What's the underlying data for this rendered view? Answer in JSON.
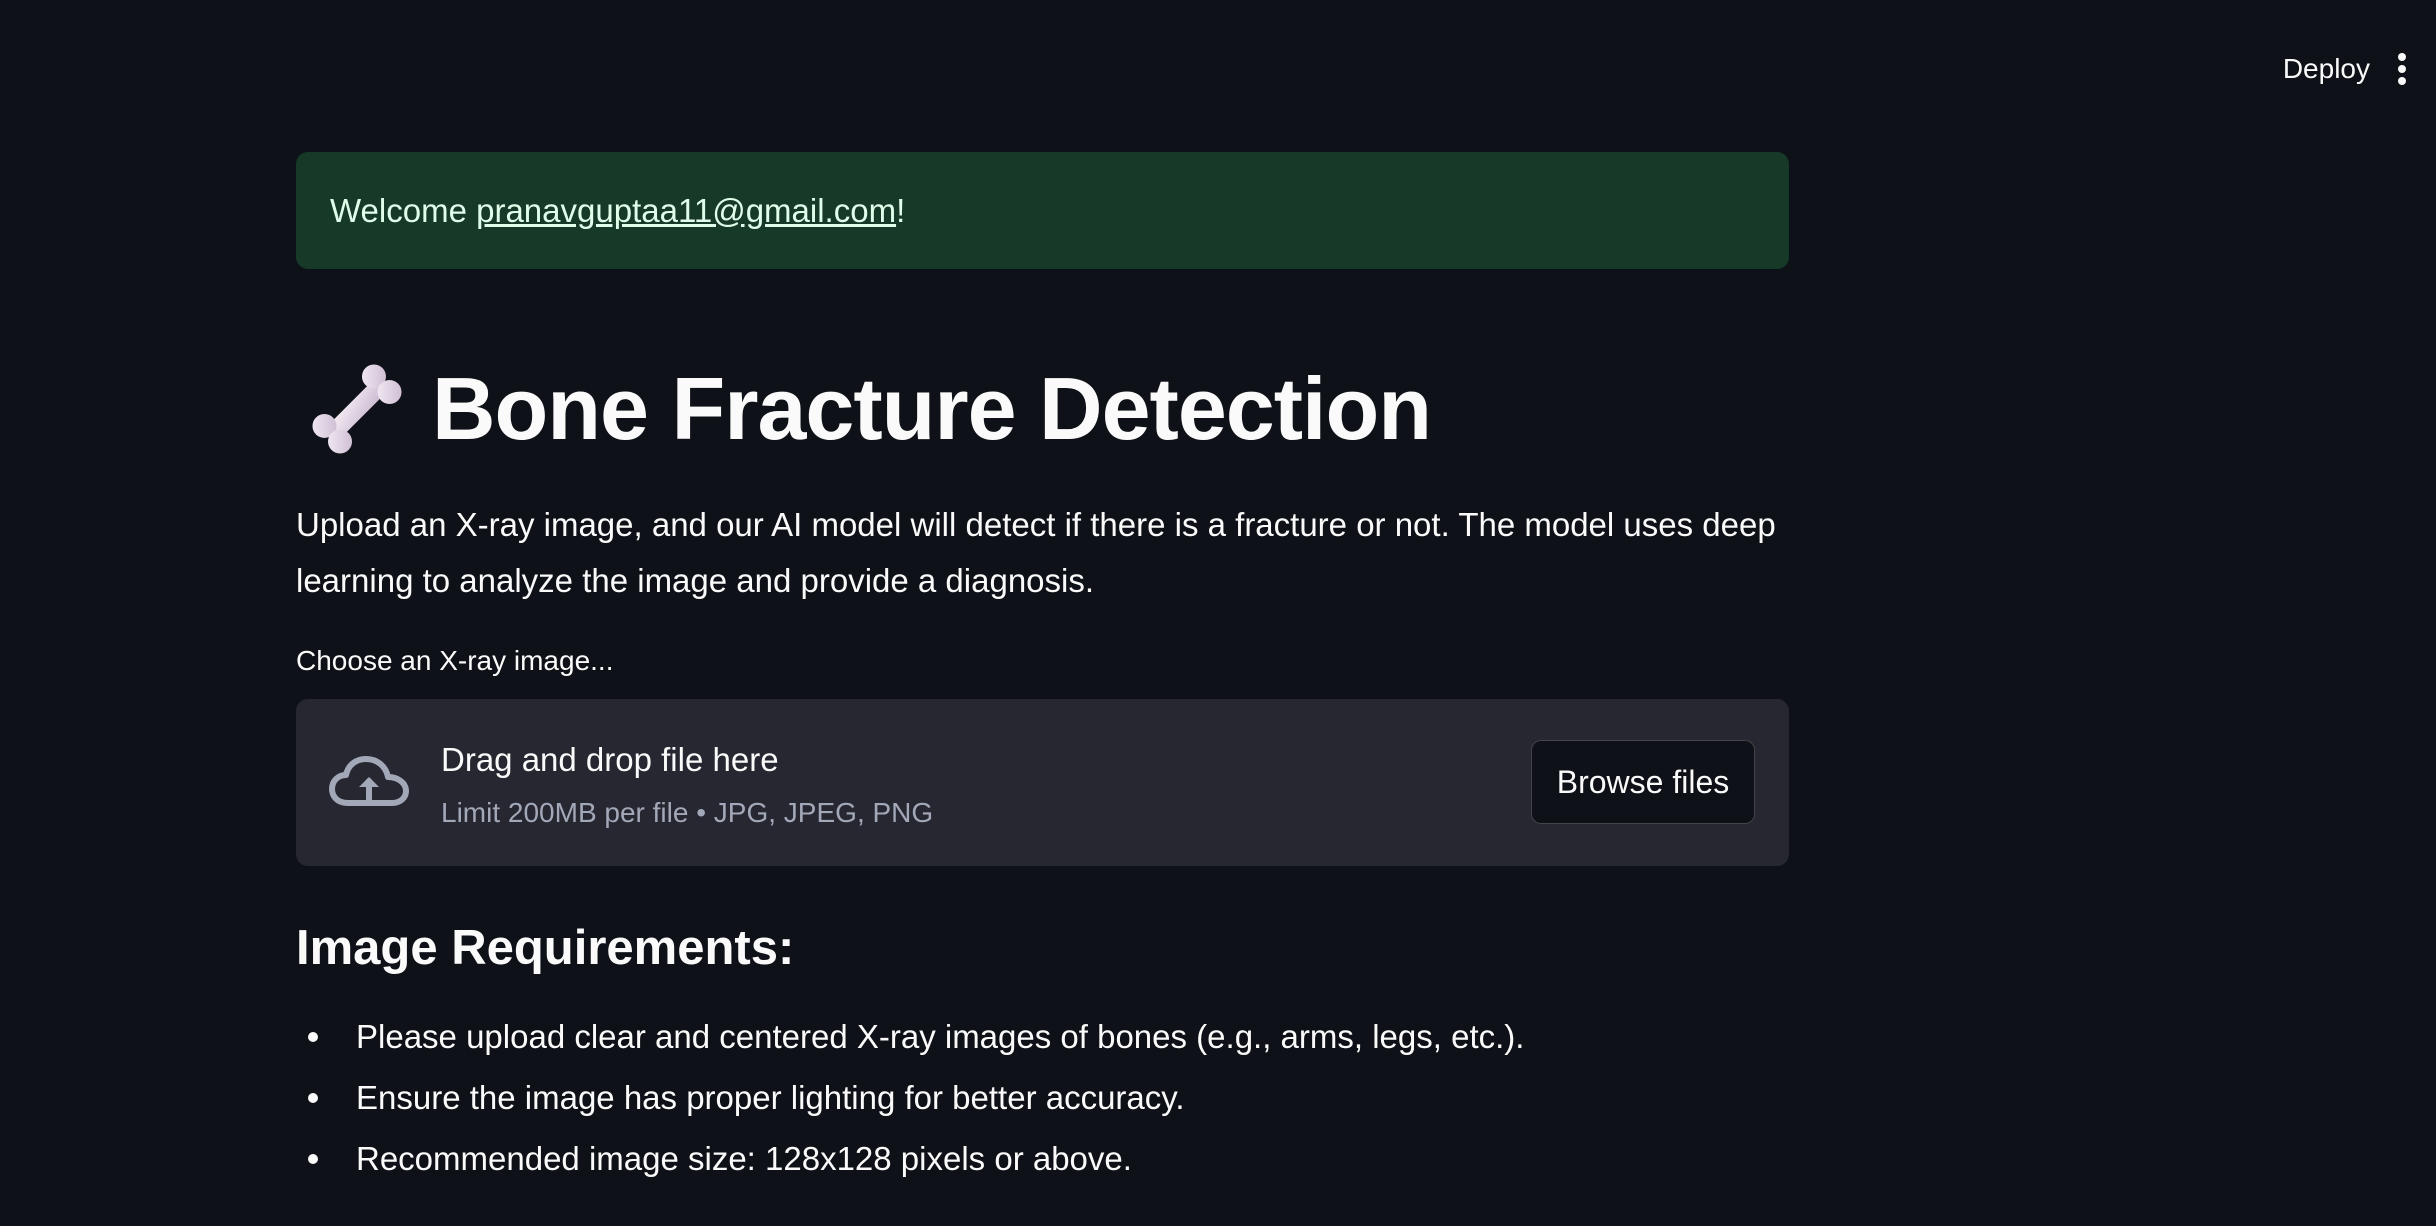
{
  "toolbar": {
    "deploy_label": "Deploy",
    "menu_icon": "vertical-ellipsis-icon"
  },
  "alert": {
    "prefix": "Welcome ",
    "email": "pranavguptaa11@gmail.com",
    "suffix": "!",
    "color": "#173928"
  },
  "header": {
    "icon": "bone-icon",
    "title": "Bone Fracture Detection"
  },
  "intro": {
    "text": "Upload an X-ray image, and our AI model will detect if there is a fracture or not. The model uses deep learning to analyze the image and provide a diagnosis."
  },
  "uploader": {
    "label": "Choose an X-ray image...",
    "icon": "cloud-upload-icon",
    "primary_text": "Drag and drop file here",
    "secondary_text": "Limit 200MB per file • JPG, JPEG, PNG",
    "browse_label": "Browse files"
  },
  "requirements": {
    "heading": "Image Requirements:",
    "items": [
      "Please upload clear and centered X-ray images of bones (e.g., arms, legs, etc.).",
      "Ensure the image has proper lighting for better accuracy.",
      "Recommended image size: 128x128 pixels or above."
    ]
  },
  "colors": {
    "background": "#0e1117",
    "dropzone": "#262730",
    "success_bg": "#173928"
  }
}
